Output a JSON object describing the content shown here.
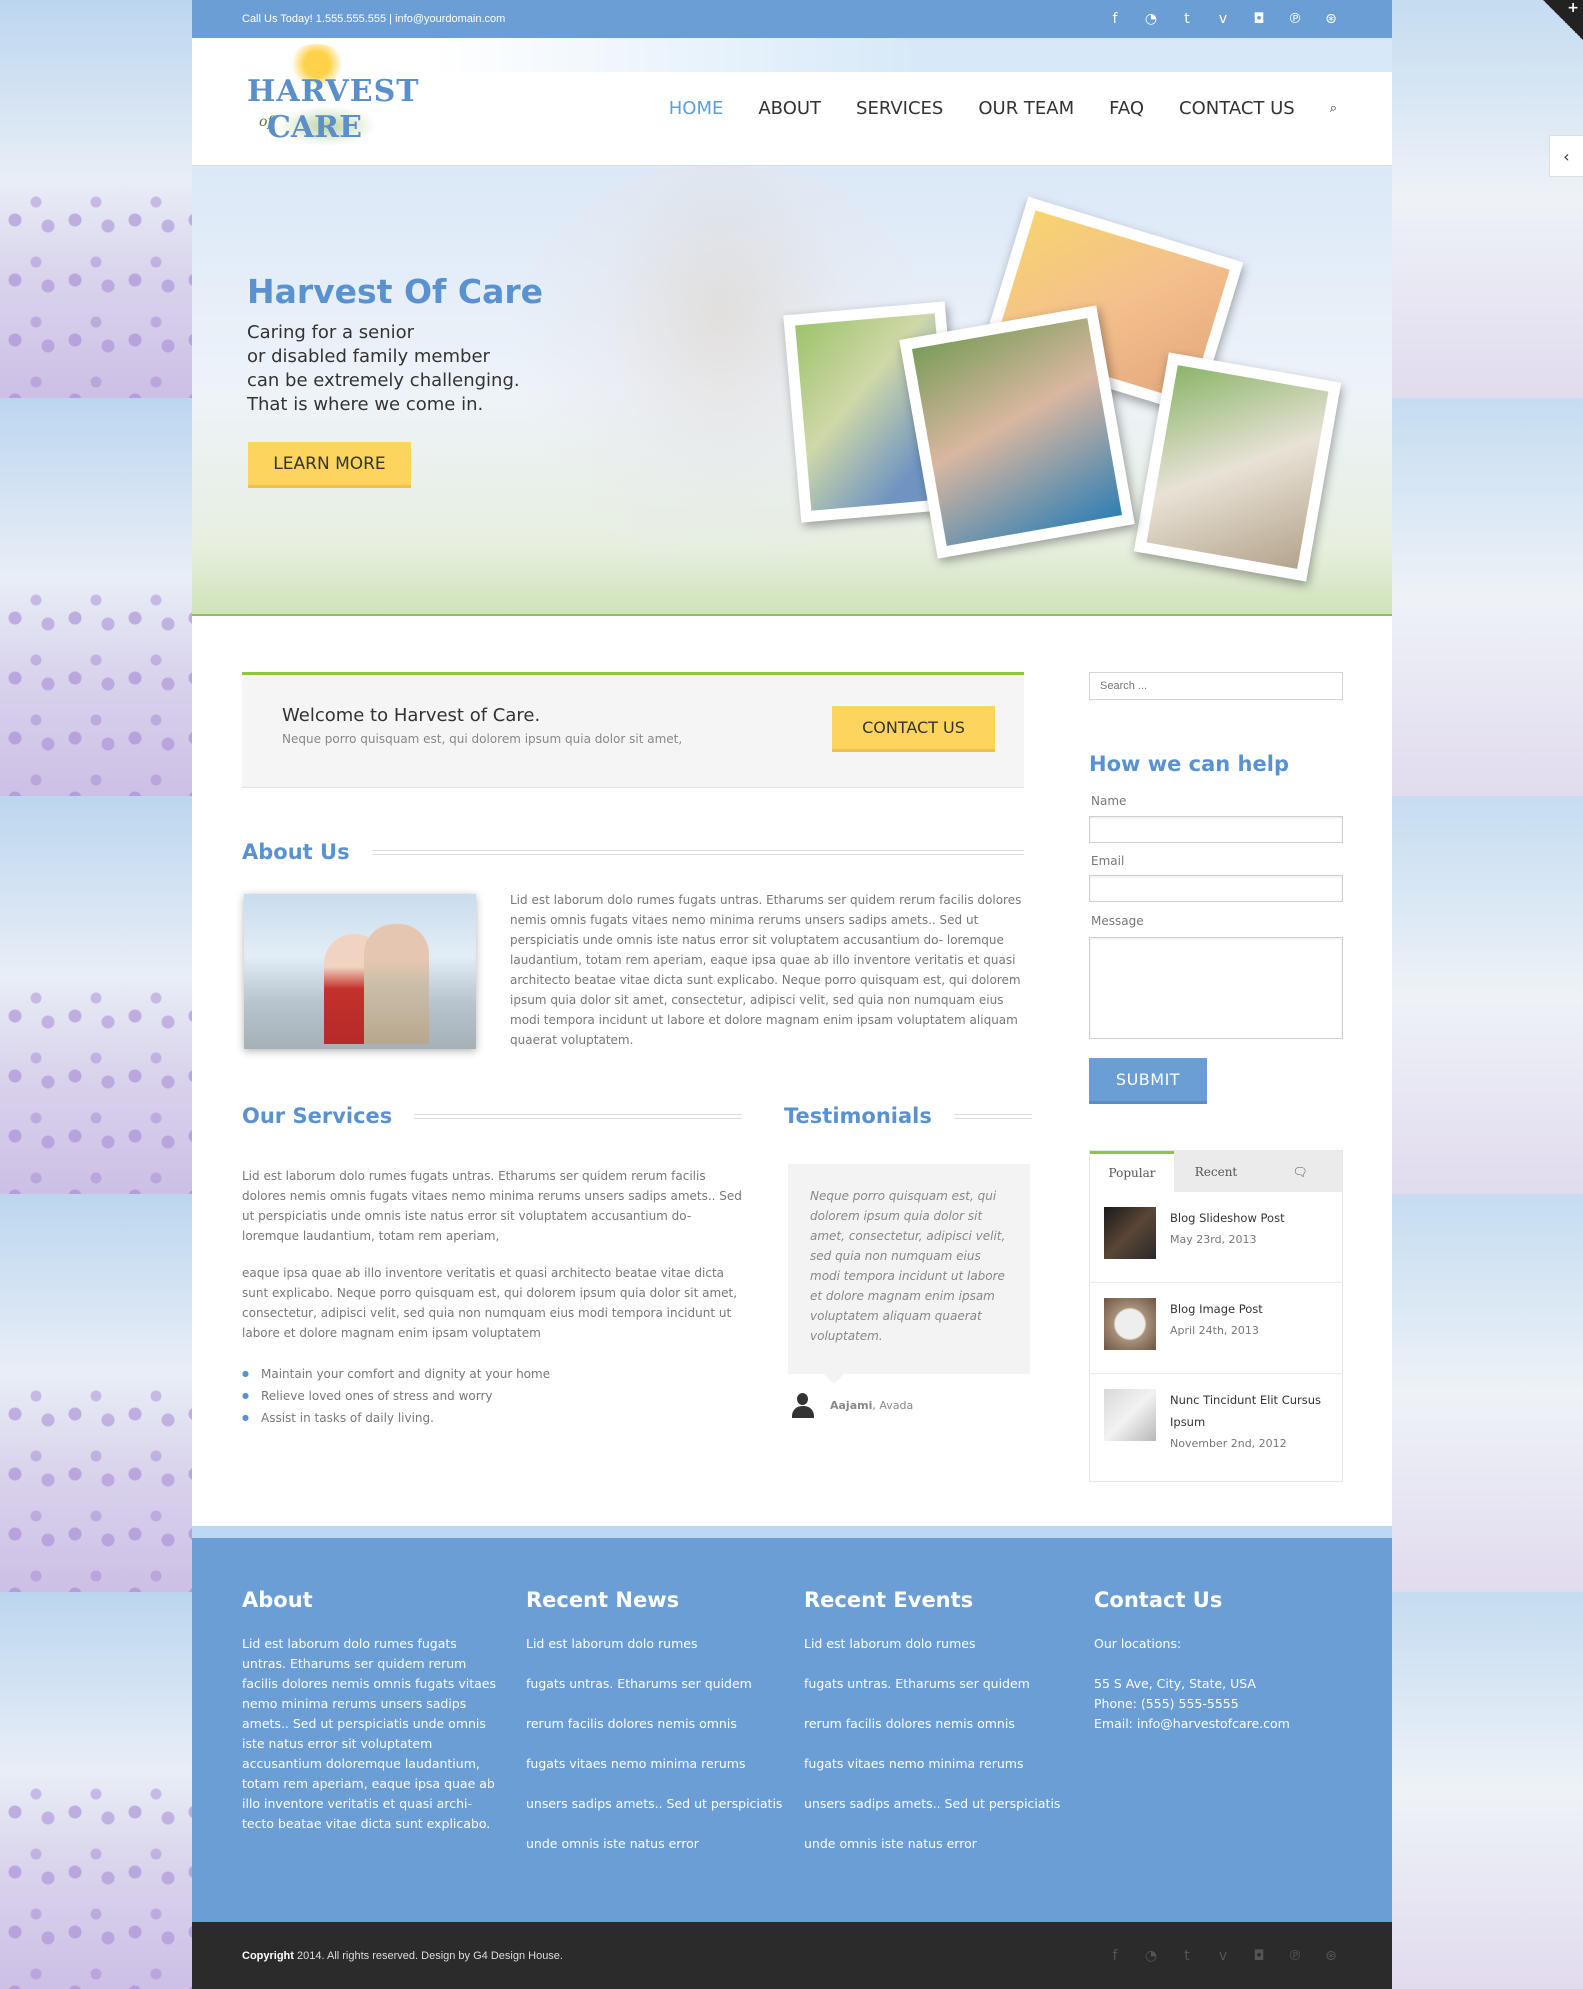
{
  "topbar": {
    "contact": "Call Us Today! 1.555.555.555  |  info@yourdomain.com",
    "social_icons": [
      "facebook-icon",
      "rss-icon",
      "twitter-icon",
      "vimeo-icon",
      "instagram-icon",
      "pinterest-icon",
      "dribbble-icon"
    ]
  },
  "social_glyphs": {
    "facebook": "f",
    "rss": "◔",
    "twitter": "t",
    "vimeo": "v",
    "instagram": "◘",
    "pinterest": "℗",
    "dribbble": "⊛"
  },
  "logo": {
    "line1": "HARVEST",
    "of": "of",
    "line2": "CARE"
  },
  "nav": {
    "home": "HOME",
    "about": "ABOUT",
    "services": "SERVICES",
    "team": "OUR TEAM",
    "faq": "FAQ",
    "contact": "CONTACT US",
    "search_icon": "⌕"
  },
  "hero": {
    "title": "Harvest Of Care",
    "line1": "Caring for a senior",
    "line2": "or disabled family member",
    "line3": "can be extremely challenging.",
    "line4": "That is where we come in.",
    "button": "LEARN MORE"
  },
  "welcome": {
    "title": "Welcome to Harvest of Care.",
    "subtitle": "Neque porro quisquam est, qui dolorem ipsum quia dolor sit amet,",
    "button": "CONTACT US"
  },
  "about": {
    "title": "About Us",
    "text": "Lid est laborum dolo rumes fugats untras. Etharums ser quidem rerum facilis dolores nemis omnis fugats vitaes nemo minima rerums unsers sadips amets.. Sed ut perspiciatis unde omnis iste natus error sit voluptatem accusantium do- loremque laudantium, totam rem aperiam, eaque ipsa quae ab illo inventore veritatis et quasi architecto beatae vitae dicta sunt explicabo. Neque porro quisquam est, qui dolorem ipsum quia dolor sit amet, consectetur, adipisci velit, sed quia non numquam eius modi tempora incidunt ut labore et dolore magnam enim ipsam voluptatem aliquam quaerat voluptatem."
  },
  "services": {
    "title": "Our Services",
    "para1": "Lid est laborum dolo rumes fugats untras. Etharums ser quidem rerum facilis dolores nemis omnis fugats vitaes nemo minima rerums unsers sadips amets.. Sed ut perspiciatis unde omnis iste natus error sit voluptatem accusantium do- loremque laudantium, totam rem aperiam,",
    "para2": "eaque ipsa quae ab illo inventore veritatis et quasi architecto beatae vitae dicta sunt explicabo. Neque porro quisquam est, qui dolorem ipsum quia dolor sit amet, consectetur, adipisci velit, sed quia non numquam eius modi tempora incidunt ut labore et dolore magnam enim ipsam voluptatem",
    "items": [
      "Maintain your comfort and dignity at your home",
      "Relieve loved ones of stress and worry",
      "Assist in tasks of daily living."
    ]
  },
  "testimonials": {
    "title": "Testimonials",
    "quote": "Neque porro quisquam est, qui dolorem ipsum quia dolor sit amet, consectetur, adipisci velit, sed quia non numquam eius modi tempora incidunt ut labore et dolore magnam enim ipsam voluptatem aliquam quaerat voluptatem.",
    "author": "Aajami",
    "company": ", Avada"
  },
  "sidebar": {
    "search_placeholder": "Search ...",
    "form_title": "How we can help",
    "name_label": "Name",
    "email_label": "Email",
    "message_label": "Message",
    "submit": "SUBMIT",
    "tabs": {
      "popular": "Popular",
      "recent": "Recent",
      "comments_icon": "🗨"
    },
    "posts": [
      {
        "title": "Blog Slideshow Post",
        "date": "May 23rd, 2013"
      },
      {
        "title": "Blog Image Post",
        "date": "April 24th, 2013"
      },
      {
        "title": "Nunc Tincidunt Elit Cursus Ipsum",
        "date": "November 2nd, 2012"
      }
    ]
  },
  "footer": {
    "about_title": "About",
    "about_text": "Lid est laborum dolo rumes fugats untras. Etharums ser quidem rerum facilis dolores nemis omnis fugats vitaes nemo minima rerums unsers sadips amets.. Sed ut perspiciatis unde omnis iste natus error sit voluptatem accusantium doloremque laudantium, totam rem aperiam, eaque ipsa quae ab illo inventore veritatis et quasi archi- tecto beatae vitae dicta sunt explicabo.",
    "news_title": "Recent News",
    "news": [
      "Lid est laborum dolo rumes",
      "fugats untras. Etharums ser quidem",
      "rerum facilis dolores nemis omnis",
      "fugats vitaes nemo minima rerums",
      "unsers sadips amets.. Sed ut perspiciatis",
      "unde omnis iste natus error"
    ],
    "events_title": "Recent Events",
    "events": [
      "Lid est laborum dolo rumes",
      "fugats untras. Etharums ser quidem",
      "rerum facilis dolores nemis omnis",
      "fugats vitaes nemo minima rerums",
      "unsers sadips amets.. Sed ut perspiciatis",
      "unde omnis iste natus error"
    ],
    "contact_title": "Contact Us",
    "locations_label": "Our locations:",
    "address": "55 S Ave, City, State, USA",
    "phone": "Phone: (555) 555-5555",
    "email": "Email: info@harvestofcare.com"
  },
  "copyright": {
    "bold": "Copyright",
    "text": " 2014. All rights reserved. Design by G4 Design House."
  },
  "edge": {
    "corner_icon": "+",
    "toggle_icon": "‹"
  },
  "colors": {
    "accent": "#5a92cf",
    "topbar": "#6a9ed4",
    "button_yellow": "#fcd45e",
    "green": "#8fc449"
  }
}
